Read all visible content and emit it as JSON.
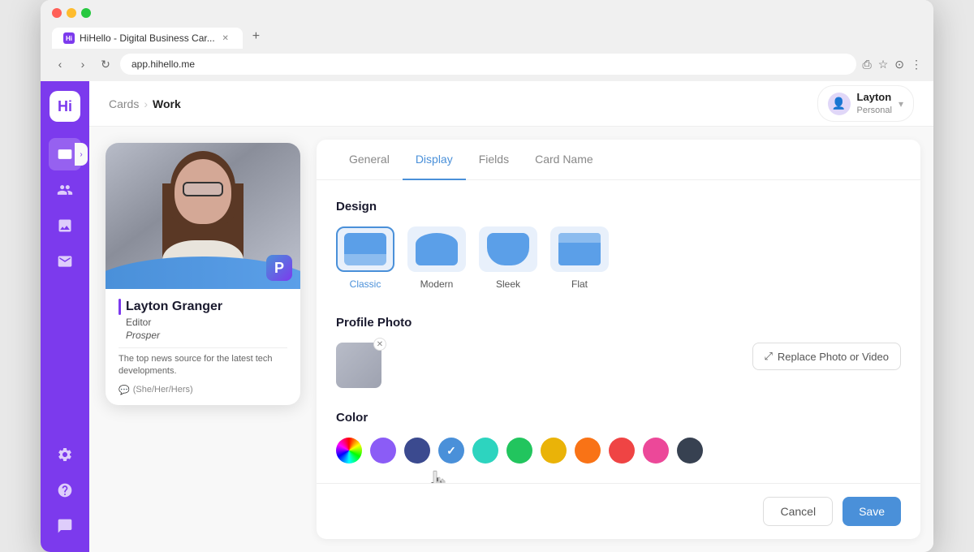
{
  "browser": {
    "tab_title": "HiHello - Digital Business Car...",
    "address": "app.hihello.me",
    "new_tab_label": "+"
  },
  "sidebar": {
    "logo": "Hi",
    "items": [
      {
        "id": "cards",
        "label": "Cards",
        "active": true
      },
      {
        "id": "contacts",
        "label": "Contacts"
      },
      {
        "id": "media",
        "label": "Media"
      },
      {
        "id": "messages",
        "label": "Messages"
      },
      {
        "id": "settings",
        "label": "Settings"
      },
      {
        "id": "help",
        "label": "Help"
      },
      {
        "id": "chat",
        "label": "Chat"
      }
    ]
  },
  "topbar": {
    "breadcrumb_root": "Cards",
    "breadcrumb_current": "Work",
    "user_name": "Layton",
    "user_role": "Personal"
  },
  "card": {
    "name": "Layton Granger",
    "title": "Editor",
    "company": "Prosper",
    "bio": "The top news source for the latest tech developments.",
    "pronouns": "(She/Her/Hers)"
  },
  "settings": {
    "tabs": [
      {
        "id": "general",
        "label": "General"
      },
      {
        "id": "display",
        "label": "Display",
        "active": true
      },
      {
        "id": "fields",
        "label": "Fields"
      },
      {
        "id": "card_name",
        "label": "Card Name"
      }
    ],
    "design_section_title": "Design",
    "design_options": [
      {
        "id": "classic",
        "label": "Classic",
        "selected": true
      },
      {
        "id": "modern",
        "label": "Modern"
      },
      {
        "id": "sleek",
        "label": "Sleek"
      },
      {
        "id": "flat",
        "label": "Flat"
      }
    ],
    "profile_photo_section_title": "Profile Photo",
    "replace_photo_btn_label": "Replace Photo or Video",
    "color_section_title": "Color",
    "colors": [
      {
        "id": "rainbow",
        "hex": "rainbow",
        "selected": false
      },
      {
        "id": "purple",
        "hex": "#8b5cf6",
        "selected": false
      },
      {
        "id": "navy",
        "hex": "#3b4a8f",
        "selected": false
      },
      {
        "id": "teal-blue",
        "hex": "#4a90d9",
        "selected": true
      },
      {
        "id": "teal",
        "hex": "#2dd4bf",
        "selected": false
      },
      {
        "id": "green",
        "hex": "#22c55e",
        "selected": false
      },
      {
        "id": "yellow",
        "hex": "#eab308",
        "selected": false
      },
      {
        "id": "orange",
        "hex": "#f97316",
        "selected": false
      },
      {
        "id": "red",
        "hex": "#ef4444",
        "selected": false
      },
      {
        "id": "pink",
        "hex": "#ec4899",
        "selected": false
      },
      {
        "id": "dark",
        "hex": "#374151",
        "selected": false
      }
    ],
    "cancel_label": "Cancel",
    "save_label": "Save"
  }
}
